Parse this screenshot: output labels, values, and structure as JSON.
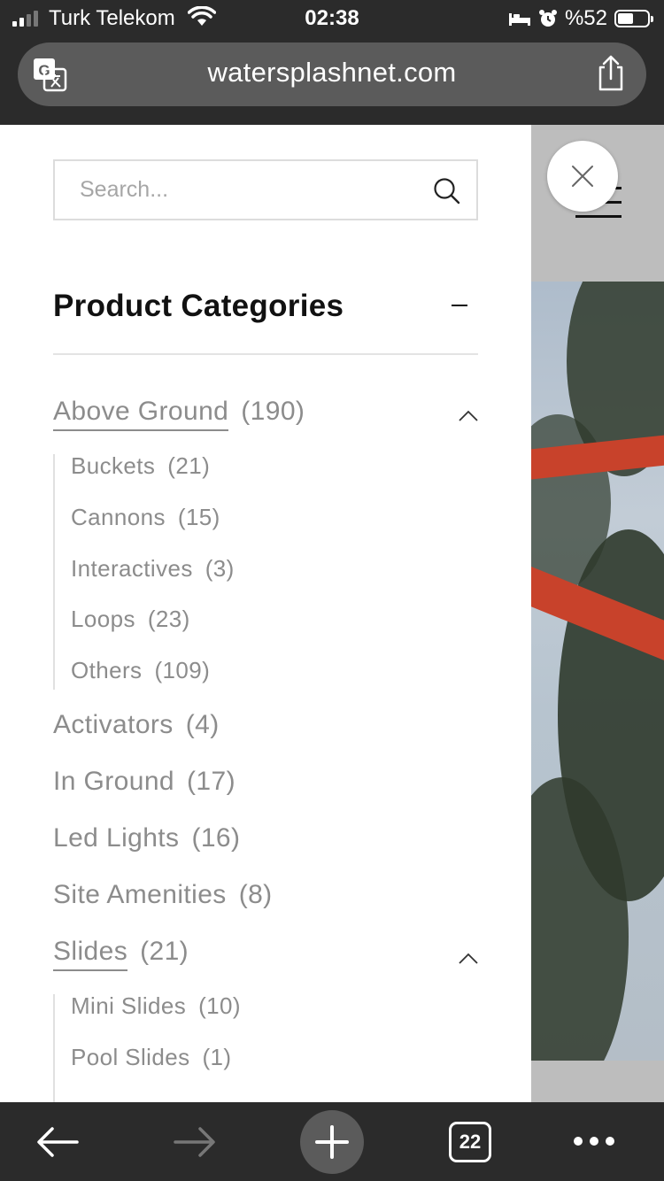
{
  "status_bar": {
    "carrier": "Turk Telekom",
    "time": "02:38",
    "battery_text": "%52",
    "battery_level": 0.52
  },
  "address_bar": {
    "url": "watersplashnet.com",
    "icons": [
      "translate-icon",
      "share-icon"
    ]
  },
  "drawer": {
    "search_placeholder": "Search...",
    "categories_title": "Product Categories",
    "categories": [
      {
        "label": "Above Ground",
        "count": "(190)",
        "expanded": true,
        "children": [
          {
            "label": "Buckets",
            "count": "(21)"
          },
          {
            "label": "Cannons",
            "count": "(15)"
          },
          {
            "label": "Interactives",
            "count": "(3)"
          },
          {
            "label": "Loops",
            "count": "(23)"
          },
          {
            "label": "Others",
            "count": "(109)"
          }
        ]
      },
      {
        "label": "Activators",
        "count": "(4)"
      },
      {
        "label": "In Ground",
        "count": "(17)"
      },
      {
        "label": "Led Lights",
        "count": "(16)"
      },
      {
        "label": "Site Amenities",
        "count": "(8)"
      },
      {
        "label": "Slides",
        "count": "(21)",
        "expanded": true,
        "children": [
          {
            "label": "Mini Slides",
            "count": "(10)"
          },
          {
            "label": "Pool Slides",
            "count": "(1)"
          }
        ]
      }
    ]
  },
  "toolbar": {
    "tab_count": "22",
    "icons": [
      "back-arrow-icon",
      "forward-arrow-icon",
      "plus-icon",
      "tabs-icon",
      "more-icon"
    ]
  },
  "colors": {
    "chrome_bg": "#2b2b2b",
    "address_bg": "#5b5b5b",
    "drawer_bg": "#ffffff",
    "category_text": "#8c8c8c",
    "title_text": "#111111",
    "accent_red": "#c8422b"
  }
}
